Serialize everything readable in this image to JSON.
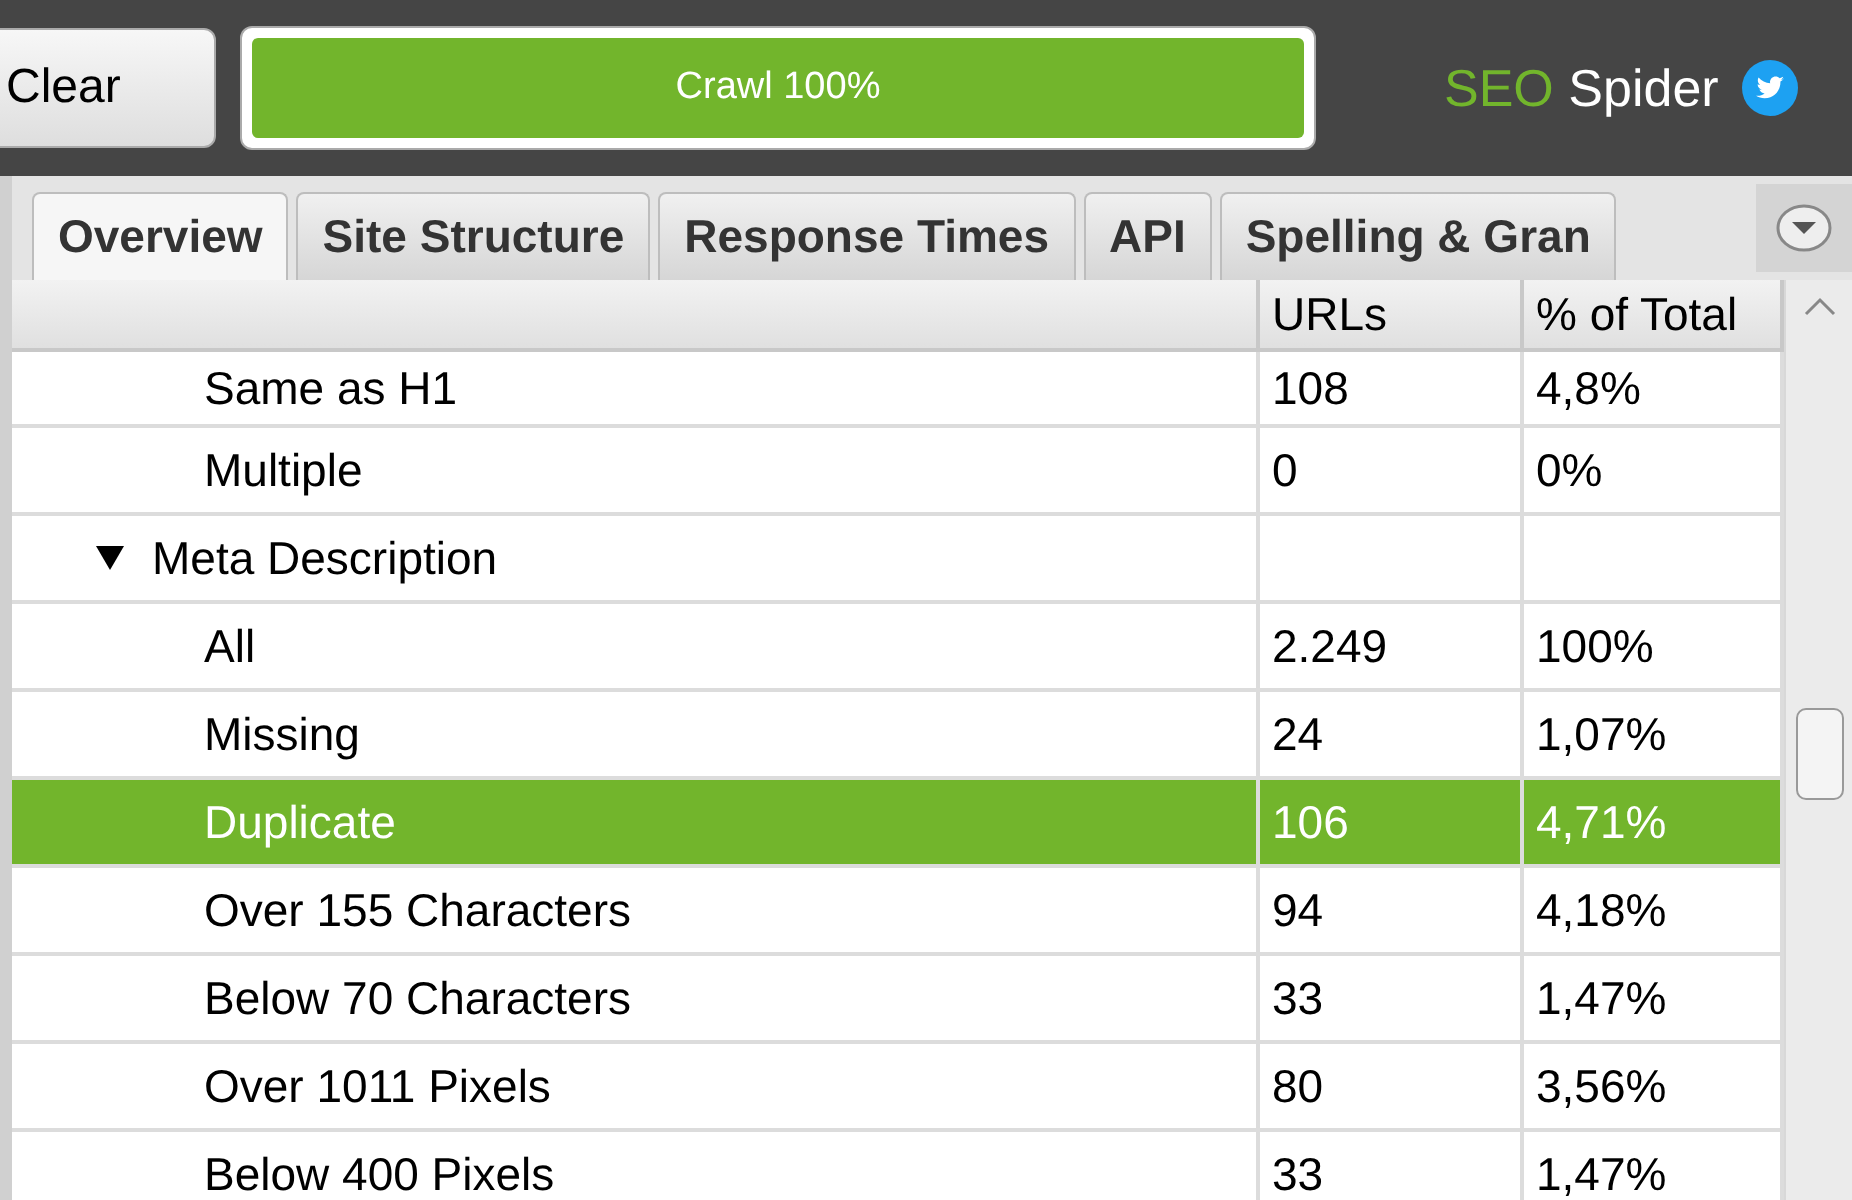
{
  "toolbar": {
    "clear_button": "Clear",
    "progress": {
      "label": "Crawl 100%",
      "level": 1
    },
    "brand": {
      "accent": "SEO",
      "name": "Spider"
    }
  },
  "tabs": [
    {
      "label": "Overview",
      "selected": true
    },
    {
      "label": "Site Structure",
      "selected": false
    },
    {
      "label": "Response Times",
      "selected": false
    },
    {
      "label": "API",
      "selected": false
    },
    {
      "label": "Spelling & Gran",
      "selected": false
    }
  ],
  "table": {
    "columns": [
      "URLs",
      "% of Total"
    ],
    "tree": [
      {
        "children": [
          {
            "label": "Same as H1",
            "urls": "108",
            "percent": "4,8%",
            "selected": false
          },
          {
            "label": "Multiple",
            "urls": "0",
            "percent": "0%",
            "selected": false
          }
        ]
      },
      {
        "label": "Meta Description",
        "expanded": true,
        "children": [
          {
            "label": "All",
            "urls": "2.249",
            "percent": "100%",
            "selected": false
          },
          {
            "label": "Missing",
            "urls": "24",
            "percent": "1,07%",
            "selected": false
          },
          {
            "label": "Duplicate",
            "urls": "106",
            "percent": "4,71%",
            "selected": true
          },
          {
            "label": "Over 155 Characters",
            "urls": "94",
            "percent": "4,18%",
            "selected": false
          },
          {
            "label": "Below 70 Characters",
            "urls": "33",
            "percent": "1,47%",
            "selected": false
          },
          {
            "label": "Over 1011 Pixels",
            "urls": "80",
            "percent": "3,56%",
            "selected": false
          },
          {
            "label": "Below 400 Pixels",
            "urls": "33",
            "percent": "1,47%",
            "selected": false
          }
        ]
      }
    ]
  }
}
